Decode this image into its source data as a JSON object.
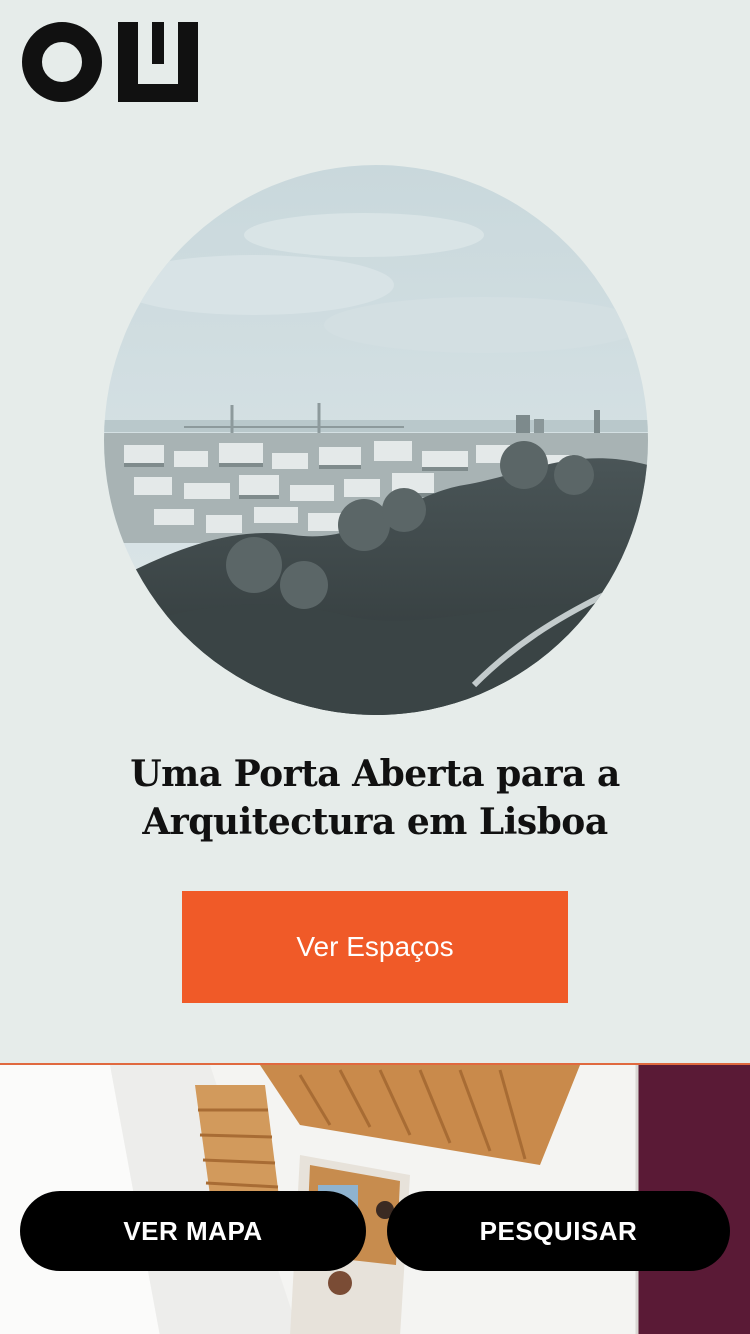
{
  "brand": {
    "logo_icon": "oh-logo-icon",
    "text_color": "#111111"
  },
  "hero": {
    "image_icon": "lisbon-cityscape-photo",
    "title_line1": "Uma Porta Aberta para a",
    "title_line2": "Arquitectura em Lisboa"
  },
  "cta": {
    "label": "Ver Espaços",
    "color": "#f05a28"
  },
  "featured": {
    "image_icon": "staircase-photo",
    "accent_color": "#5a1a36"
  },
  "bottom_nav": {
    "map_label": "VER MAPA",
    "search_label": "PESQUISAR"
  },
  "colors": {
    "background": "#e6ecea",
    "button_dark": "#000000"
  }
}
